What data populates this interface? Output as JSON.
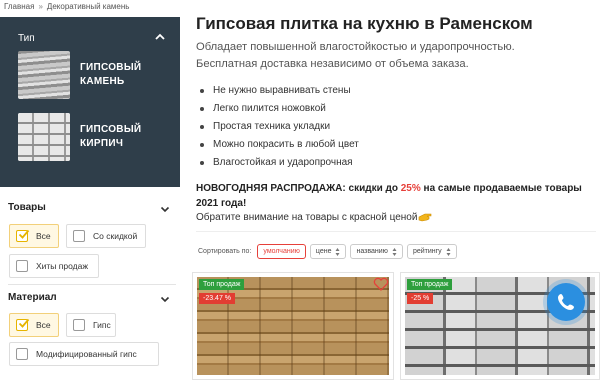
{
  "breadcrumb": {
    "items": [
      "Главная",
      "Декоративный камень"
    ],
    "separator": "»"
  },
  "type_panel": {
    "title": "Тип",
    "items": [
      {
        "label_line1": "гипсовый",
        "label_line2": "камень"
      },
      {
        "label_line1": "гипсовый",
        "label_line2": "кирпич"
      }
    ]
  },
  "filters": {
    "goods": {
      "title": "Товары",
      "options": [
        {
          "label": "Все",
          "checked": true
        },
        {
          "label": "Со скидкой",
          "checked": false
        },
        {
          "label": "Хиты продаж",
          "checked": false
        }
      ]
    },
    "material": {
      "title": "Материал",
      "options": [
        {
          "label": "Все",
          "checked": true
        },
        {
          "label": "Гипс",
          "checked": false
        },
        {
          "label": "Модифицированный гипс",
          "checked": false
        }
      ]
    }
  },
  "main": {
    "title": "Гипсовая плитка на кухню в Раменском",
    "subtitle_line1": "Обладает повышенной влагостойкостью и ударопрочностью.",
    "subtitle_line2": "Бесплатная доставка независимо от объема заказа.",
    "features": [
      "Не нужно выравнивать стены",
      "Легко пилится ножовкой",
      "Простая техника укладки",
      "Можно покрасить в любой цвет",
      "Влагостойкая и ударопрочная"
    ],
    "promo_part1": "НОВОГОДНЯЯ РАСПРОДАЖА: скидки до ",
    "promo_percent": "25%",
    "promo_part2": " на самые продаваемые товары 2021 года!",
    "promo_note": "Обратите внимание на товары с красной ценой"
  },
  "sort": {
    "label": "Сортировать по:",
    "options": [
      "умолчанию",
      "цене",
      "названию",
      "рейтингу"
    ],
    "active": "умолчанию"
  },
  "products": [
    {
      "badge": "Топ продаж",
      "discount": "-23.47 %"
    },
    {
      "badge": "Топ продаж",
      "discount": "-25 %"
    }
  ],
  "colors": {
    "panel": "#2f3e4a",
    "accent_red": "#e6403a",
    "badge_green": "#2e9f3d",
    "checkbox_active": "#fff8e3",
    "phone_button": "#2b8fe0"
  },
  "icons": [
    "chevron-down-icon",
    "checkmark-icon",
    "sort-arrows-icon",
    "heart-icon",
    "phone-icon",
    "pointing-hand-icon"
  ]
}
